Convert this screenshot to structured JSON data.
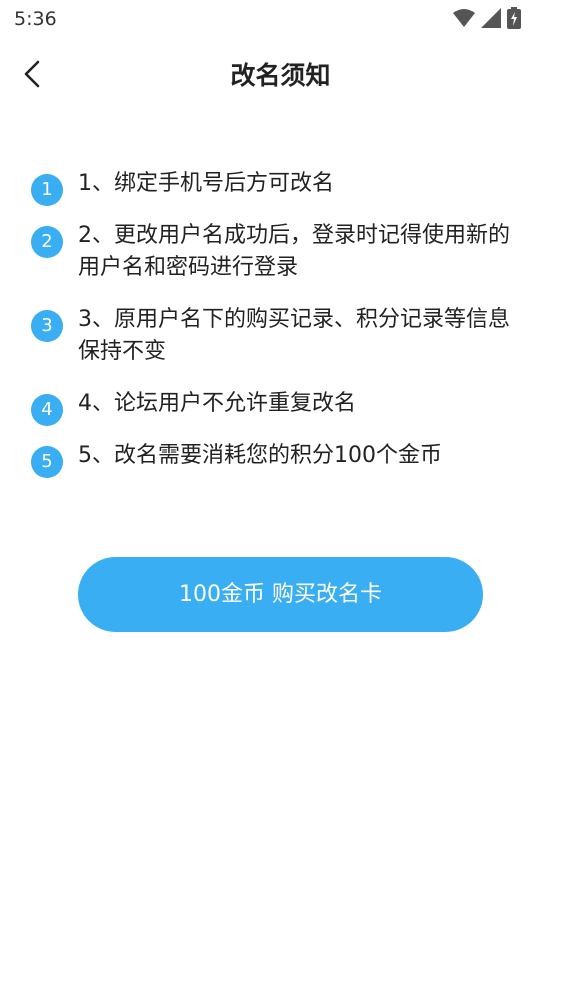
{
  "status_bar": {
    "time": "5:36",
    "icons": [
      "wifi-icon",
      "signal-icon",
      "battery-icon"
    ]
  },
  "header": {
    "title": "改名须知",
    "back_icon": "chevron-left-icon"
  },
  "notices": [
    {
      "num": "1",
      "text": "1、绑定手机号后方可改名"
    },
    {
      "num": "2",
      "text": "2、更改用户名成功后，登录时记得使用新的用户名和密码进行登录"
    },
    {
      "num": "3",
      "text": "3、原用户名下的购买记录、积分记录等信息保持不变"
    },
    {
      "num": "4",
      "text": "4、论坛用户不允许重复改名"
    },
    {
      "num": "5",
      "text": "5、改名需要消耗您的积分100个金币"
    }
  ],
  "action": {
    "buy_label": "100金币 购买改名卡"
  },
  "colors": {
    "accent": "#3aaef2",
    "text": "#222222",
    "background": "#ffffff"
  }
}
